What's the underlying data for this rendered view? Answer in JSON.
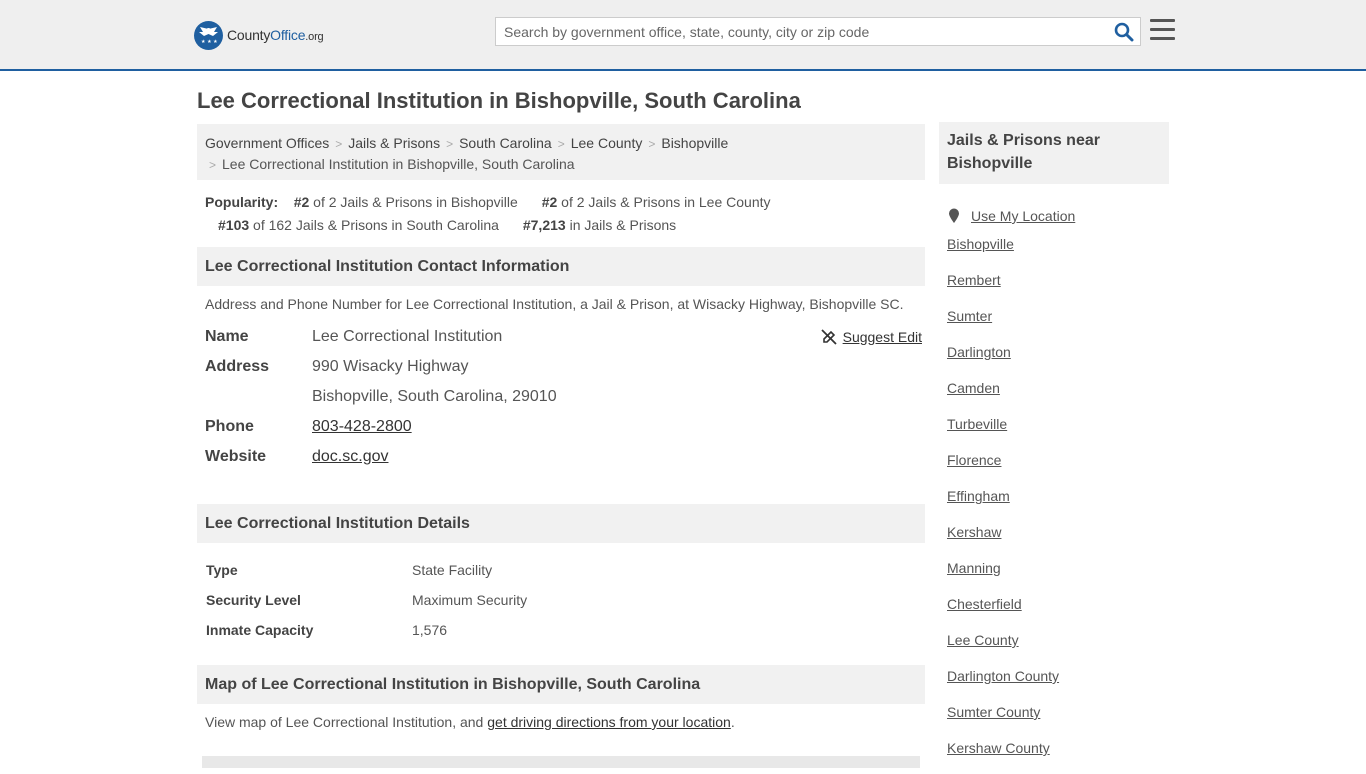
{
  "header": {
    "logo_main": "County",
    "logo_brand": "Office",
    "logo_tld": ".org",
    "search_placeholder": "Search by government office, state, county, city or zip code"
  },
  "page_title": "Lee Correctional Institution in Bishopville, South Carolina",
  "breadcrumb": {
    "items": [
      "Government Offices",
      "Jails & Prisons",
      "South Carolina",
      "Lee County",
      "Bishopville"
    ],
    "current": "Lee Correctional Institution in Bishopville, South Carolina"
  },
  "popularity": {
    "label": "Popularity:",
    "ranks": [
      {
        "rank": "#2",
        "text": " of 2 Jails & Prisons in Bishopville"
      },
      {
        "rank": "#2",
        "text": " of 2 Jails & Prisons in Lee County"
      },
      {
        "rank": "#103",
        "text": " of 162 Jails & Prisons in South Carolina"
      },
      {
        "rank": "#7,213",
        "text": " in Jails & Prisons"
      }
    ]
  },
  "contact": {
    "heading": "Lee Correctional Institution Contact Information",
    "description": "Address and Phone Number for Lee Correctional Institution, a Jail & Prison, at Wisacky Highway, Bishopville SC.",
    "suggest_edit": "Suggest Edit",
    "name_label": "Name",
    "name": "Lee Correctional Institution",
    "address_label": "Address",
    "address_line1": "990 Wisacky Highway",
    "address_line2": "Bishopville, South Carolina, 29010",
    "phone_label": "Phone",
    "phone": "803-428-2800",
    "website_label": "Website",
    "website": "doc.sc.gov"
  },
  "details": {
    "heading": "Lee Correctional Institution Details",
    "rows": [
      {
        "label": "Type",
        "value": "State Facility"
      },
      {
        "label": "Security Level",
        "value": "Maximum Security"
      },
      {
        "label": "Inmate Capacity",
        "value": "1,576"
      }
    ]
  },
  "map": {
    "heading": "Map of Lee Correctional Institution in Bishopville, South Carolina",
    "text_before": "View map of Lee Correctional Institution, and ",
    "link": "get driving directions from your location",
    "text_after": "."
  },
  "sidebar": {
    "heading": "Jails & Prisons near Bishopville",
    "use_location": "Use My Location",
    "links": [
      "Bishopville",
      "Rembert",
      "Sumter",
      "Darlington",
      "Camden",
      "Turbeville",
      "Florence",
      "Effingham",
      "Kershaw",
      "Manning",
      "Chesterfield",
      "Lee County",
      "Darlington County",
      "Sumter County",
      "Kershaw County"
    ]
  },
  "colors": {
    "brand_blue": "#1f5fa0",
    "section_bg": "#f1f1f1",
    "topbar_bg": "#efefef"
  }
}
